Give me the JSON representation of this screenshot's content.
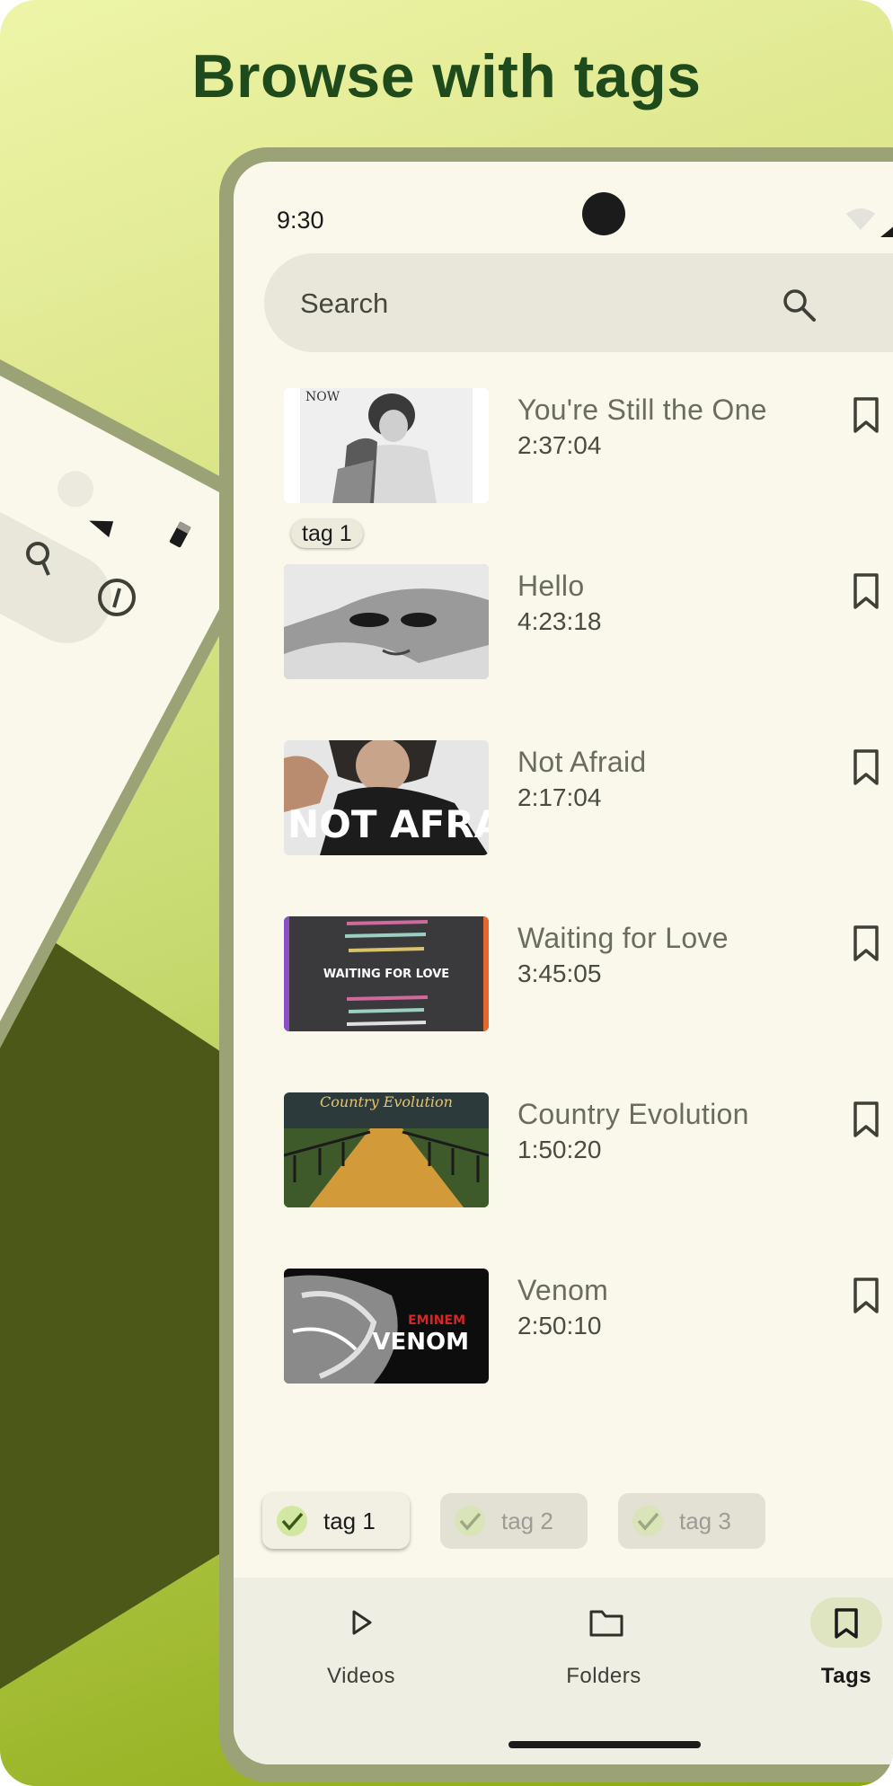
{
  "promo": {
    "title": "Browse with tags"
  },
  "status_bar": {
    "time": "9:30"
  },
  "search": {
    "placeholder": "Search"
  },
  "videos": [
    {
      "title": "You're Still the One",
      "duration": "2:37:04",
      "tag": "tag 1"
    },
    {
      "title": "Hello",
      "duration": "4:23:18"
    },
    {
      "title": "Not Afraid",
      "duration": "2:17:04"
    },
    {
      "title": "Waiting for Love",
      "duration": "3:45:05"
    },
    {
      "title": "Country Evolution",
      "duration": "1:50:20"
    },
    {
      "title": "Venom",
      "duration": "2:50:10"
    }
  ],
  "thumbnail_text": {
    "now": "NOW",
    "not_afraid": "NOT AFRAID",
    "waiting": "WAITING FOR LOVE",
    "country": "Country Evolution",
    "eminem": "EMINEM",
    "venom": "VENOM"
  },
  "filters": [
    {
      "label": "tag 1",
      "selected": true
    },
    {
      "label": "tag 2",
      "selected": false
    },
    {
      "label": "tag 3",
      "selected": false
    }
  ],
  "bottom_nav": [
    {
      "label": "Videos",
      "icon": "play-icon"
    },
    {
      "label": "Folders",
      "icon": "folder-icon"
    },
    {
      "label": "Tags",
      "icon": "bookmark-icon",
      "active": true
    }
  ],
  "colors": {
    "title": "#1f4a1c",
    "screen_bg": "#f9f8ea",
    "accent_chip": "#d2e7a2",
    "dark_olive": "#4b5818"
  }
}
